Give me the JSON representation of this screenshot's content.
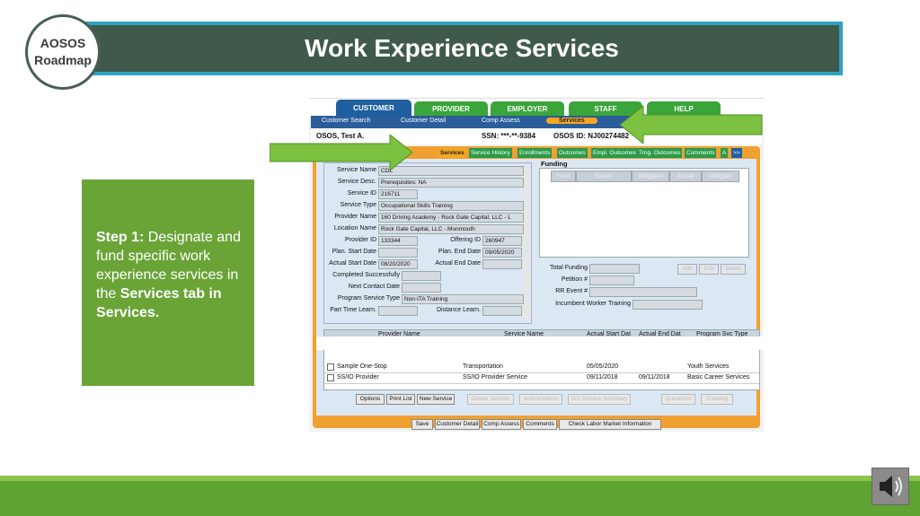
{
  "slide": {
    "title": "Work Experience Services",
    "badge_line1": "AOSOS",
    "badge_line2": "Roadmap",
    "step_bold": "Step 1:",
    "step_text": " Designate and fund specific work experience services in the ",
    "step_bold2": "Services tab in Services."
  },
  "colors": {
    "title_bg": "#3f5a4b",
    "title_border": "#2fa1c4",
    "step_bg": "#6aa437",
    "bottom_bar": "#5fa333",
    "arrow": "#7cc13f"
  },
  "app": {
    "main_tabs": [
      "CUSTOMER",
      "PROVIDER",
      "EMPLOYER",
      "STAFF",
      "HELP"
    ],
    "sub_nav": [
      "Customer Search",
      "Customer Detail",
      "Comp Assess",
      "Services"
    ],
    "user": {
      "name": "OSOS, Test A.",
      "ssn": "SSN: ***-**-9384",
      "osos_id": "OSOS ID: NJ00274482"
    },
    "sub_tabs": [
      "Services",
      "Service History",
      "Enrollments",
      "Outcomes",
      "Empl. Outcomes",
      "Trng. Outcomes",
      "Comments",
      "A",
      ">>"
    ],
    "form": {
      "service_name_label": "Service Name",
      "service_name": "CDL",
      "service_desc_label": "Service Desc.",
      "service_desc": "Prerequisites: NA",
      "service_id_label": "Service ID",
      "service_id": "216711",
      "service_type_label": "Service Type",
      "service_type": "Occupational Skills Training",
      "provider_name_label": "Provider Name",
      "provider_name": "160 Driving Academy - Rock Gate Capital, LLC - L",
      "location_name_label": "Location Name",
      "location_name": "Rock Gate Capital, LLC - Monmouth",
      "provider_id_label": "Provider ID",
      "provider_id": "133344",
      "offering_id_label": "Offering ID",
      "offering_id": "260947",
      "plan_start_label": "Plan. Start Date",
      "plan_end_label": "Plan. End Date",
      "plan_end": "09/05/2020",
      "actual_start_label": "Actual Start Date",
      "actual_start": "08/20/2020",
      "actual_end_label": "Actual End Date",
      "completed_label": "Completed Successfully",
      "next_contact_label": "Next Contact Date",
      "program_type_label": "Program Service Type",
      "program_type": "Non-ITA Training",
      "part_time_label": "Part Time Learn.",
      "distance_label": "Distance Learn."
    },
    "funding": {
      "title": "Funding",
      "columns": [
        "Fund",
        "Source",
        "Obligated",
        "Actual",
        "Obligate"
      ],
      "total_label": "Total Funding",
      "petition_label": "Petition #",
      "rr_label": "RR Event #",
      "incumbent_label": "Incumbent Worker Training",
      "buttons": [
        "Add",
        "Edit",
        "Delete"
      ]
    },
    "grid": {
      "columns": [
        "Provider Name",
        "Service Name",
        "Actual Start Dat",
        "Actual End Dat",
        "Program Svc Type"
      ],
      "rows": [
        {
          "provider": "Sample One-Stop",
          "service": "Transportation",
          "start": "05/05/2020",
          "end": "",
          "type": "Youth Services"
        },
        {
          "provider": "SS/IO Provider",
          "service": "SS/IO Provider Service",
          "start": "09/11/2018",
          "end": "09/11/2018",
          "type": "Basic Career Services"
        }
      ]
    },
    "action_buttons": [
      "Options",
      "Print List",
      "New Service",
      "Delete Service",
      "Authorization",
      "ISS Service Summary",
      "Questions",
      "Tracking"
    ],
    "bottom_buttons": [
      "Save",
      "Customer Detail",
      "Comp Assess",
      "Comments",
      "Check Labor Market Information"
    ]
  }
}
